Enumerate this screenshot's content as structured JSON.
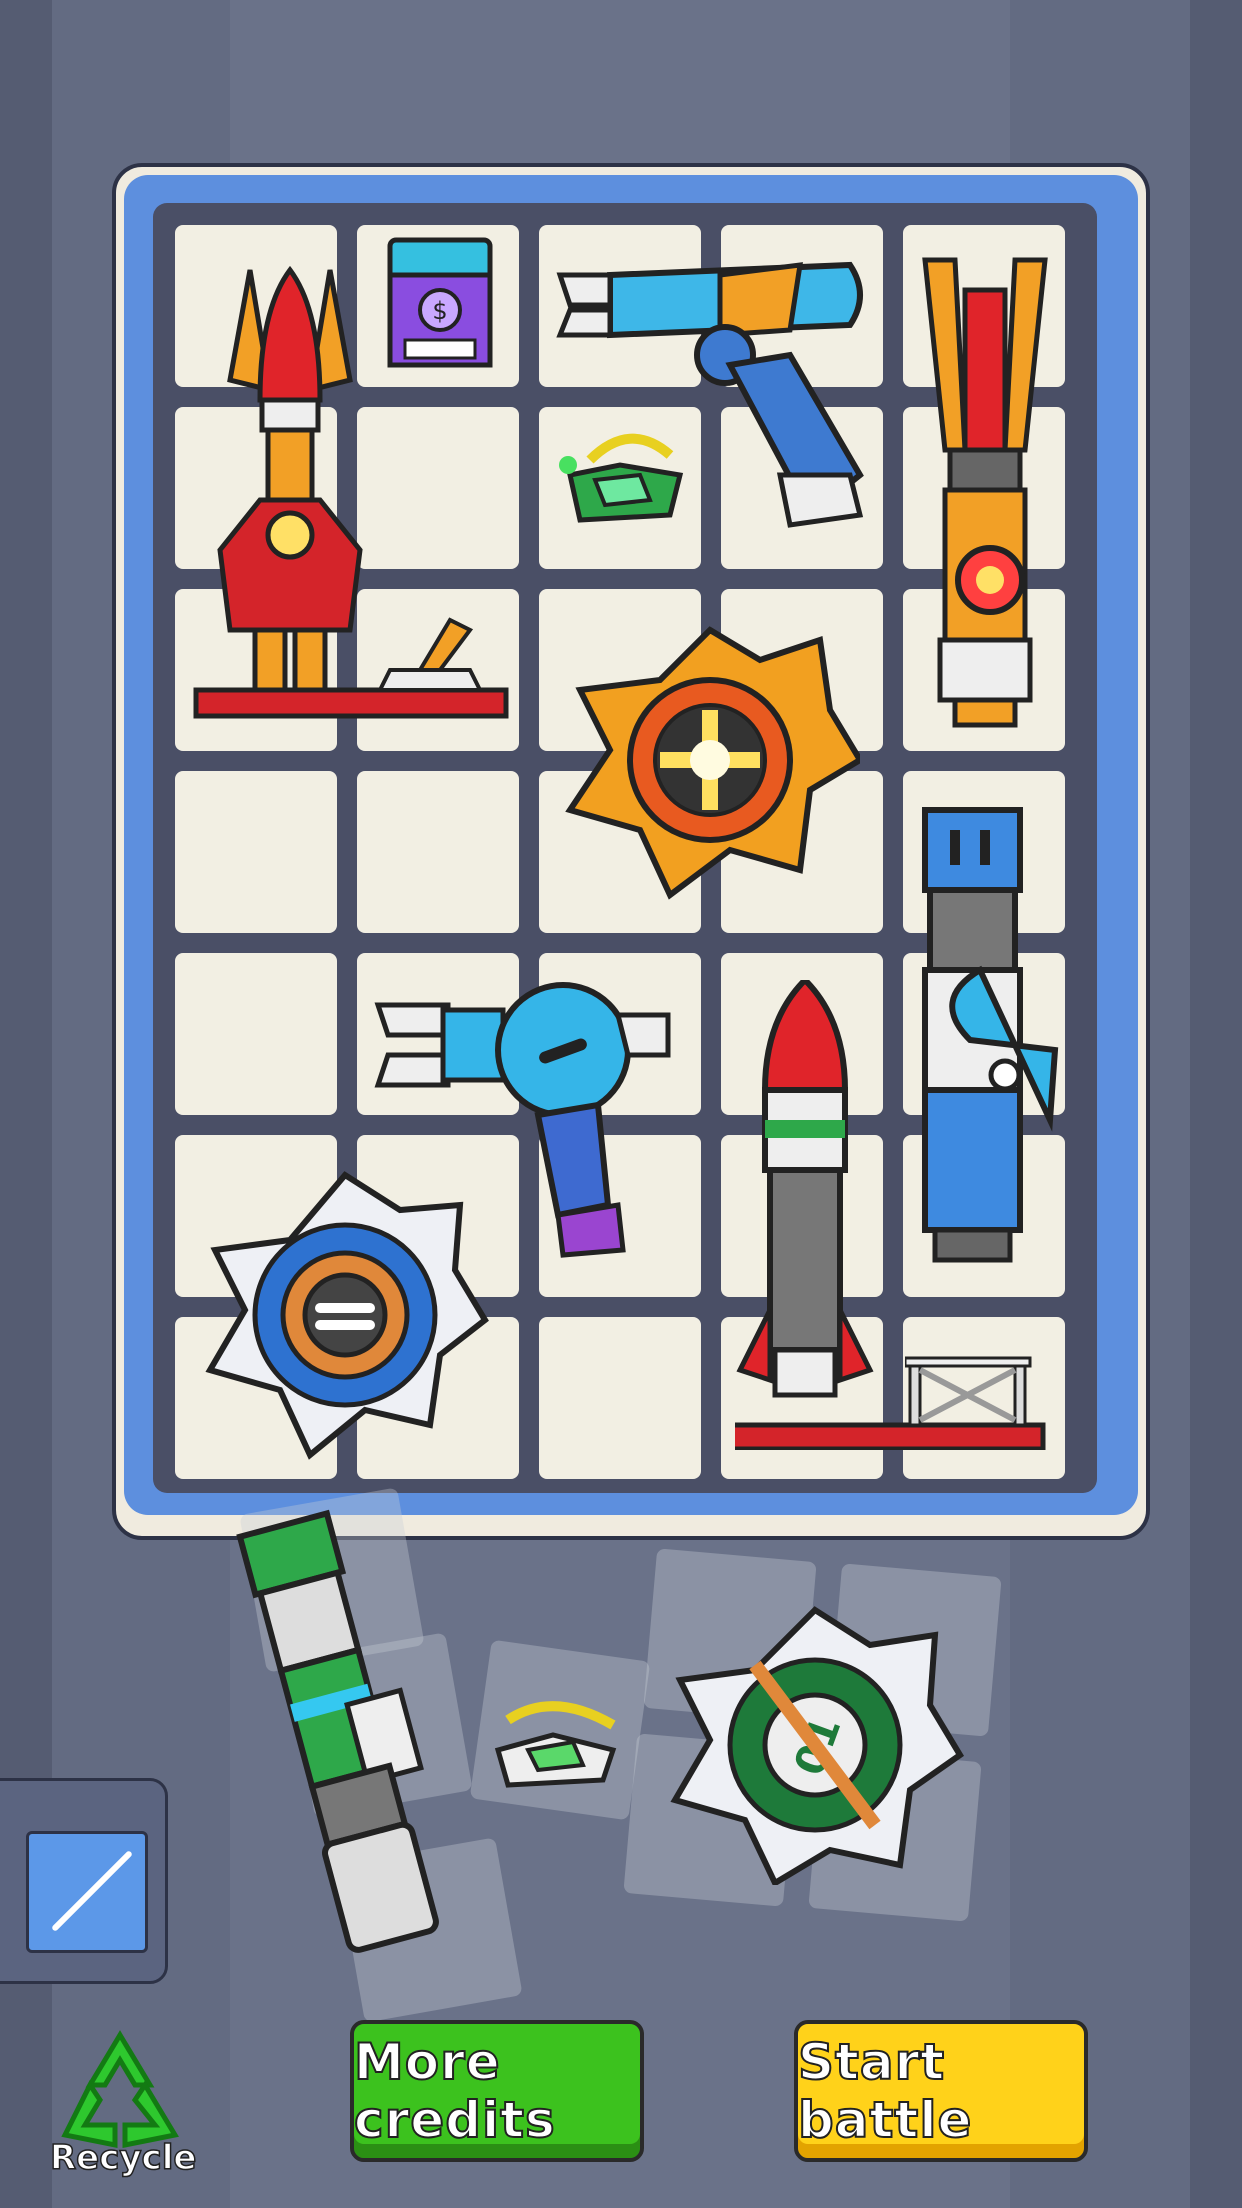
{
  "buttons": {
    "more_credits": "More credits",
    "start_battle": "Start battle",
    "recycle": "Recycle"
  },
  "colors": {
    "background": "#636b82",
    "board_frame": "#5d8fde",
    "cell": "#f2efe3",
    "green_button": "#3cc21e",
    "yellow_button": "#ffd21a"
  },
  "board": {
    "columns": 5,
    "rows": 7,
    "items": [
      {
        "name": "red-rocket-launcher-icon"
      },
      {
        "name": "credit-card-chip-icon"
      },
      {
        "name": "blue-claw-blaster-icon"
      },
      {
        "name": "orange-laser-cannon-icon"
      },
      {
        "name": "green-energy-module-icon"
      },
      {
        "name": "orange-claw-turret-icon"
      },
      {
        "name": "orange-sawblade-icon"
      },
      {
        "name": "blue-laser-cannon-icon"
      },
      {
        "name": "blue-claw-gun-icon"
      },
      {
        "name": "red-white-missile-icon"
      },
      {
        "name": "blue-sawblade-icon"
      },
      {
        "name": "metal-scaffold-icon"
      }
    ]
  },
  "tray": {
    "items": [
      {
        "name": "green-laser-baton-icon"
      },
      {
        "name": "small-energy-module-icon"
      },
      {
        "name": "green-sawblade-icon"
      }
    ]
  }
}
